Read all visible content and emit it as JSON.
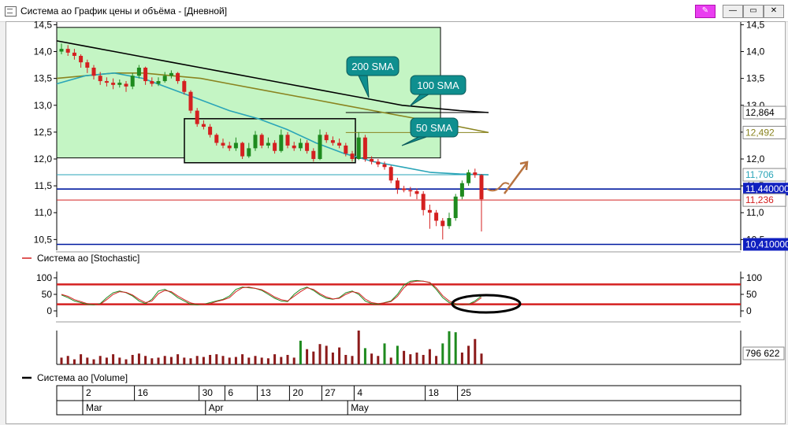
{
  "window": {
    "title": "Система ао График цены и объёма - [Дневной]",
    "buttons": [
      "pin",
      "minimize",
      "maximize",
      "close"
    ]
  },
  "colors": {
    "candle_up": "#1e8a1e",
    "candle_down": "#d42020",
    "sma50": "#2aa5b8",
    "sma100": "#8a8420",
    "sma200": "#000000",
    "support_line": "#001aa0",
    "resistance_line": "#d42020",
    "highlight_fill": "#c4f5c4",
    "callout_fill": "#0f8f8f",
    "arrow": "#b87340"
  },
  "panels": {
    "stochastic_label": "Система ао [Stochastic]",
    "volume_label": "Система ао [Volume]",
    "volume_value": "796 622"
  },
  "chart_data": [
    {
      "type": "candlestick",
      "panel": "price",
      "ylim": [
        10.3,
        14.55
      ],
      "ytick_labels": [
        "14,5",
        "14,0",
        "13,5",
        "13,0",
        "12,5",
        "12,0",
        "11,5",
        "11,0",
        "10,5"
      ],
      "ytick_values": [
        14.5,
        14.0,
        13.5,
        13.0,
        12.5,
        12.0,
        11.5,
        11.0,
        10.5
      ],
      "x_count": 66,
      "candles": [
        {
          "o": 14.0,
          "c": 14.05,
          "h": 14.15,
          "l": 13.95
        },
        {
          "o": 14.05,
          "c": 13.98,
          "h": 14.12,
          "l": 13.92
        },
        {
          "o": 13.98,
          "c": 13.92,
          "h": 14.05,
          "l": 13.85
        },
        {
          "o": 13.92,
          "c": 13.8,
          "h": 13.95,
          "l": 13.7
        },
        {
          "o": 13.8,
          "c": 13.7,
          "h": 13.85,
          "l": 13.6
        },
        {
          "o": 13.7,
          "c": 13.55,
          "h": 13.75,
          "l": 13.48
        },
        {
          "o": 13.55,
          "c": 13.45,
          "h": 13.62,
          "l": 13.38
        },
        {
          "o": 13.45,
          "c": 13.42,
          "h": 13.52,
          "l": 13.35
        },
        {
          "o": 13.42,
          "c": 13.38,
          "h": 13.5,
          "l": 13.3
        },
        {
          "o": 13.38,
          "c": 13.42,
          "h": 13.48,
          "l": 13.33
        },
        {
          "o": 13.4,
          "c": 13.35,
          "h": 13.45,
          "l": 13.25
        },
        {
          "o": 13.35,
          "c": 13.55,
          "h": 13.6,
          "l": 13.3
        },
        {
          "o": 13.55,
          "c": 13.7,
          "h": 13.75,
          "l": 13.5
        },
        {
          "o": 13.7,
          "c": 13.45,
          "h": 13.72,
          "l": 13.38
        },
        {
          "o": 13.45,
          "c": 13.4,
          "h": 13.52,
          "l": 13.35
        },
        {
          "o": 13.4,
          "c": 13.45,
          "h": 13.52,
          "l": 13.36
        },
        {
          "o": 13.45,
          "c": 13.55,
          "h": 13.62,
          "l": 13.42
        },
        {
          "o": 13.55,
          "c": 13.6,
          "h": 13.65,
          "l": 13.5
        },
        {
          "o": 13.6,
          "c": 13.45,
          "h": 13.62,
          "l": 13.4
        },
        {
          "o": 13.45,
          "c": 13.25,
          "h": 13.48,
          "l": 13.2
        },
        {
          "o": 13.25,
          "c": 12.9,
          "h": 13.28,
          "l": 12.85
        },
        {
          "o": 12.9,
          "c": 12.65,
          "h": 12.95,
          "l": 12.6
        },
        {
          "o": 12.65,
          "c": 12.6,
          "h": 12.72,
          "l": 12.55
        },
        {
          "o": 12.6,
          "c": 12.45,
          "h": 12.65,
          "l": 12.4
        },
        {
          "o": 12.45,
          "c": 12.3,
          "h": 12.48,
          "l": 12.25
        },
        {
          "o": 12.3,
          "c": 12.25,
          "h": 12.38,
          "l": 12.2
        },
        {
          "o": 12.25,
          "c": 12.2,
          "h": 12.32,
          "l": 12.15
        },
        {
          "o": 12.2,
          "c": 12.3,
          "h": 12.4,
          "l": 12.15
        },
        {
          "o": 12.3,
          "c": 12.05,
          "h": 12.32,
          "l": 12.0
        },
        {
          "o": 12.05,
          "c": 12.2,
          "h": 12.3,
          "l": 12.02
        },
        {
          "o": 12.2,
          "c": 12.45,
          "h": 12.52,
          "l": 12.15
        },
        {
          "o": 12.45,
          "c": 12.25,
          "h": 12.48,
          "l": 12.2
        },
        {
          "o": 12.25,
          "c": 12.3,
          "h": 12.4,
          "l": 12.2
        },
        {
          "o": 12.3,
          "c": 12.15,
          "h": 12.35,
          "l": 12.1
        },
        {
          "o": 12.15,
          "c": 12.45,
          "h": 12.55,
          "l": 12.12
        },
        {
          "o": 12.45,
          "c": 12.25,
          "h": 12.5,
          "l": 12.2
        },
        {
          "o": 12.25,
          "c": 12.2,
          "h": 12.32,
          "l": 12.15
        },
        {
          "o": 12.2,
          "c": 12.3,
          "h": 12.38,
          "l": 12.15
        },
        {
          "o": 12.3,
          "c": 12.15,
          "h": 12.35,
          "l": 12.1
        },
        {
          "o": 12.15,
          "c": 12.0,
          "h": 12.2,
          "l": 11.95
        },
        {
          "o": 12.0,
          "c": 12.45,
          "h": 12.55,
          "l": 11.98
        },
        {
          "o": 12.45,
          "c": 12.35,
          "h": 12.5,
          "l": 12.3
        },
        {
          "o": 12.35,
          "c": 12.3,
          "h": 12.42,
          "l": 12.25
        },
        {
          "o": 12.3,
          "c": 12.25,
          "h": 12.38,
          "l": 12.2
        },
        {
          "o": 12.25,
          "c": 12.1,
          "h": 12.3,
          "l": 12.05
        },
        {
          "o": 12.1,
          "c": 12.0,
          "h": 12.15,
          "l": 11.95
        },
        {
          "o": 12.0,
          "c": 12.4,
          "h": 12.5,
          "l": 11.98
        },
        {
          "o": 12.4,
          "c": 12.0,
          "h": 12.45,
          "l": 11.95
        },
        {
          "o": 12.0,
          "c": 11.95,
          "h": 12.05,
          "l": 11.9
        },
        {
          "o": 11.95,
          "c": 11.9,
          "h": 12.0,
          "l": 11.85
        },
        {
          "o": 11.9,
          "c": 11.85,
          "h": 11.95,
          "l": 11.8
        },
        {
          "o": 11.85,
          "c": 11.6,
          "h": 11.88,
          "l": 11.55
        },
        {
          "o": 11.6,
          "c": 11.45,
          "h": 11.65,
          "l": 11.35
        },
        {
          "o": 11.45,
          "c": 11.42,
          "h": 11.5,
          "l": 11.38
        },
        {
          "o": 11.42,
          "c": 11.4,
          "h": 11.48,
          "l": 11.3
        },
        {
          "o": 11.4,
          "c": 11.35,
          "h": 11.45,
          "l": 11.25
        },
        {
          "o": 11.35,
          "c": 11.05,
          "h": 11.4,
          "l": 10.95
        },
        {
          "o": 11.05,
          "c": 11.0,
          "h": 11.15,
          "l": 10.7
        },
        {
          "o": 11.0,
          "c": 10.85,
          "h": 11.05,
          "l": 10.75
        },
        {
          "o": 10.85,
          "c": 10.75,
          "h": 10.9,
          "l": 10.5
        },
        {
          "o": 10.75,
          "c": 10.9,
          "h": 11.0,
          "l": 10.7
        },
        {
          "o": 10.9,
          "c": 11.3,
          "h": 11.35,
          "l": 10.85
        },
        {
          "o": 11.3,
          "c": 11.55,
          "h": 11.6,
          "l": 11.25
        },
        {
          "o": 11.55,
          "c": 11.75,
          "h": 11.8,
          "l": 11.5
        },
        {
          "o": 11.75,
          "c": 11.7,
          "h": 11.82,
          "l": 11.65
        },
        {
          "o": 11.7,
          "c": 11.25,
          "h": 11.72,
          "l": 10.65
        }
      ],
      "sma_200": [
        14.2,
        14.1,
        14.0,
        13.9,
        13.8,
        13.7,
        13.6,
        13.5,
        13.4,
        13.3,
        13.2,
        13.1,
        13.0,
        12.95,
        12.9,
        12.864
      ],
      "sma_100": [
        13.5,
        13.55,
        13.6,
        13.6,
        13.55,
        13.5,
        13.4,
        13.3,
        13.2,
        13.1,
        13.0,
        12.9,
        12.8,
        12.7,
        12.6,
        12.492
      ],
      "sma_50": [
        13.4,
        13.55,
        13.6,
        13.5,
        13.3,
        13.1,
        12.9,
        12.75,
        12.55,
        12.3,
        12.1,
        11.95,
        11.85,
        11.75,
        11.72,
        11.706
      ],
      "hlines": [
        {
          "value": 12.864,
          "label": "12,864",
          "color": "#000000"
        },
        {
          "value": 12.492,
          "label": "12,492",
          "color": "#8a8420"
        },
        {
          "value": 11.706,
          "label": "11,706",
          "color": "#2aa5b8"
        },
        {
          "value": 11.44,
          "label": "11,440000",
          "color": "#001aa0",
          "highlight": true
        },
        {
          "value": 11.236,
          "label": "11,236",
          "color": "#d42020"
        },
        {
          "value": 10.41,
          "label": "10,410000",
          "color": "#001aa0",
          "highlight": true
        }
      ],
      "callouts": [
        {
          "text": "200 SMA"
        },
        {
          "text": "100 SMA"
        },
        {
          "text": "50 SMA"
        }
      ]
    },
    {
      "type": "line",
      "panel": "stochastic",
      "ylim": [
        0,
        100
      ],
      "ytick_labels": [
        "100",
        "50",
        "0"
      ],
      "ytick_values": [
        100,
        50,
        0
      ],
      "levels": [
        80,
        20
      ],
      "series": [
        {
          "values": [
            48,
            40,
            30,
            25,
            20,
            18,
            22,
            40,
            55,
            60,
            55,
            45,
            30,
            22,
            35,
            60,
            65,
            55,
            40,
            30,
            20,
            18,
            20,
            25,
            30,
            35,
            45,
            65,
            72,
            70,
            68,
            62,
            50,
            38,
            30,
            28,
            50,
            65,
            72,
            62,
            48,
            38,
            35,
            40,
            55,
            60,
            50,
            30,
            22,
            20,
            25,
            30,
            50,
            78,
            90,
            92,
            90,
            85,
            65,
            40,
            25,
            20,
            18,
            20,
            30,
            45
          ]
        },
        {
          "values": [
            50,
            44,
            34,
            28,
            22,
            20,
            20,
            34,
            50,
            58,
            56,
            48,
            35,
            25,
            30,
            52,
            62,
            58,
            45,
            34,
            24,
            20,
            20,
            22,
            28,
            33,
            40,
            58,
            70,
            72,
            68,
            64,
            54,
            42,
            34,
            30,
            44,
            58,
            70,
            65,
            52,
            42,
            36,
            38,
            50,
            58,
            54,
            36,
            25,
            22,
            24,
            28,
            44,
            70,
            86,
            90,
            90,
            86,
            70,
            46,
            30,
            22,
            18,
            19,
            26,
            40
          ]
        }
      ]
    },
    {
      "type": "bar",
      "panel": "volume",
      "values_relative": [
        0.2,
        0.25,
        0.15,
        0.3,
        0.2,
        0.15,
        0.25,
        0.2,
        0.3,
        0.2,
        0.15,
        0.28,
        0.32,
        0.25,
        0.18,
        0.2,
        0.25,
        0.22,
        0.3,
        0.2,
        0.18,
        0.25,
        0.22,
        0.28,
        0.3,
        0.25,
        0.2,
        0.22,
        0.3,
        0.2,
        0.25,
        0.2,
        0.18,
        0.3,
        0.22,
        0.28,
        0.2,
        0.7,
        0.45,
        0.38,
        0.6,
        0.55,
        0.35,
        0.5,
        0.28,
        0.25,
        1.0,
        0.48,
        0.32,
        0.25,
        0.62,
        0.2,
        0.55,
        0.4,
        0.3,
        0.35,
        0.28,
        0.45,
        0.25,
        0.62,
        0.98,
        0.95,
        0.35,
        0.55,
        0.75,
        0.32
      ],
      "up_indices": [
        37,
        47,
        50,
        52,
        59,
        60,
        61
      ]
    }
  ],
  "time_axis": {
    "day_labels": [
      {
        "text": "2",
        "index": 0
      },
      {
        "text": "16",
        "index": 8
      },
      {
        "text": "30",
        "index": 18
      },
      {
        "text": "6",
        "index": 22
      },
      {
        "text": "13",
        "index": 27
      },
      {
        "text": "20",
        "index": 32
      },
      {
        "text": "27",
        "index": 37
      },
      {
        "text": "4",
        "index": 42
      },
      {
        "text": "18",
        "index": 53
      },
      {
        "text": "25",
        "index": 58
      }
    ],
    "month_labels": [
      {
        "text": "Mar",
        "index": 0
      },
      {
        "text": "Apr",
        "index": 19
      },
      {
        "text": "May",
        "index": 41
      }
    ]
  }
}
